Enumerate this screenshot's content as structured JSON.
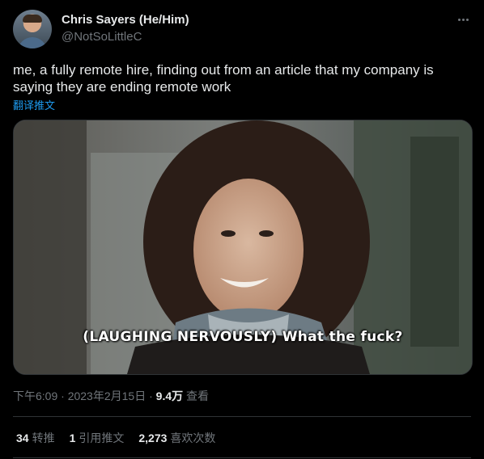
{
  "author": {
    "name": "Chris Sayers (He/Him)",
    "handle": "@NotSoLittleC"
  },
  "tweet": {
    "text": "me, a fully remote hire, finding out from an article that my company is saying they are ending remote work",
    "translate_label": "翻译推文",
    "media_caption": "(LAUGHING NERVOUSLY) What the fuck?"
  },
  "meta": {
    "time": "下午6:09",
    "separator": " · ",
    "date": "2023年2月15日",
    "separator2": " · ",
    "views": "9.4万",
    "views_label": " 查看"
  },
  "stats": {
    "retweets": "34",
    "retweets_label": "转推",
    "quotes": "1",
    "quotes_label": "引用推文",
    "likes": "2,273",
    "likes_label": "喜欢次数"
  },
  "icons": {
    "more": "more-horizontal-icon"
  },
  "colors": {
    "background": "#000000",
    "text_primary": "#e7e9ea",
    "text_secondary": "#71767b",
    "link": "#1d9bf0",
    "divider": "#2f3336"
  }
}
